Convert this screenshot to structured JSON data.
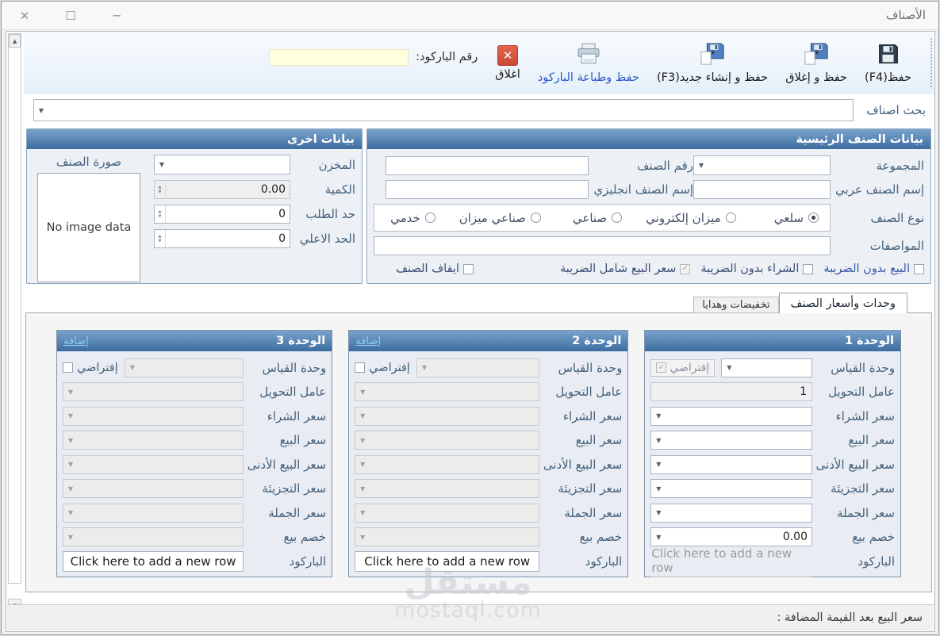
{
  "window": {
    "title": "الأصناف"
  },
  "toolbar": {
    "buttons": [
      {
        "label": "حفظ(F4)",
        "icon": "floppy-disk"
      },
      {
        "label": "حفظ و إغلاق",
        "icon": "floppy-disk-new"
      },
      {
        "label": "حفظ و إنشاء جديد(F3)",
        "icon": "floppy-disk-new"
      },
      {
        "label": "حفظ وطباعة الباركود",
        "icon": "printer"
      },
      {
        "label": "اغلاق",
        "icon": "close-x"
      }
    ],
    "barcode_label": "رقم الباركود:",
    "barcode_value": ""
  },
  "search": {
    "label": "بحث اصناف",
    "value": ""
  },
  "main_data": {
    "title": "بيانات الصنف الرئيسية",
    "group_label": "المجموعة",
    "item_no_label": "رقم الصنف",
    "name_ar_label": "إسم الصنف عربي",
    "name_en_label": "إسم الصنف انجليزي",
    "type_label": "نوع الصنف",
    "types": [
      {
        "label": "سلعي",
        "checked": true
      },
      {
        "label": "ميزان إلكتروني",
        "checked": false
      },
      {
        "label": "صناعي",
        "checked": false
      },
      {
        "label": "صناعي ميزان",
        "checked": false
      },
      {
        "label": "خدمي",
        "checked": false
      }
    ],
    "specs_label": "المواصفات",
    "checkboxes": [
      {
        "label": "البيع بدون الضريبة",
        "checked": false
      },
      {
        "label": "الشراء بدون الضريبة",
        "checked": false
      },
      {
        "label": "سعر البيع شامل الضريبة",
        "checked": true
      },
      {
        "label": "ايقاف الصنف",
        "checked": false
      }
    ]
  },
  "other_data": {
    "title": "بيانات اخرى",
    "warehouse_label": "المخزن",
    "qty_label": "الكمية",
    "qty_value": "0.00",
    "reorder_label": "حد الطلب",
    "reorder_value": "0",
    "max_label": "الحد الاعلي",
    "max_value": "0",
    "image_label": "صورة الصنف",
    "no_image_text": "No image data"
  },
  "tabs": [
    {
      "label": "وحدات وأسعار الصنف",
      "active": true
    },
    {
      "label": "تخفيضات وهدايا",
      "active": false
    }
  ],
  "units": {
    "labels": {
      "measure": "وحدة القياس",
      "conversion": "عامل التحويل",
      "buy": "سعر الشراء",
      "sell": "سعر البيع",
      "min_sell": "سعر البيع الأدنى",
      "retail": "سعر التجزيئة",
      "wholesale": "سعر الجملة",
      "discount": "خصم بيع",
      "barcode": "الباركود"
    },
    "add_link": "إضافة",
    "default_label": "إفتراضي",
    "add_row_text": "Click here to add a new row",
    "panels": [
      {
        "title": "الوحدة 1",
        "conversion": "1",
        "discount": "0.00",
        "default_checked": true
      },
      {
        "title": "الوحدة 2",
        "conversion": "",
        "discount": "",
        "default_checked": false
      },
      {
        "title": "الوحدة 3",
        "conversion": "",
        "discount": "",
        "default_checked": false
      }
    ]
  },
  "statusbar": {
    "label": "سعر البيع بعد القيمة المضافة :"
  },
  "watermark": {
    "line1": "مستقل",
    "line2": "mostaql.com"
  },
  "colors": {
    "header_blue": "#3c6c9f",
    "add_link_blue": "#8ed0f0",
    "close_red": "#c94a38",
    "barcode_field_bg": "#ffffdd",
    "save_print_label": "#2b5bc7"
  }
}
